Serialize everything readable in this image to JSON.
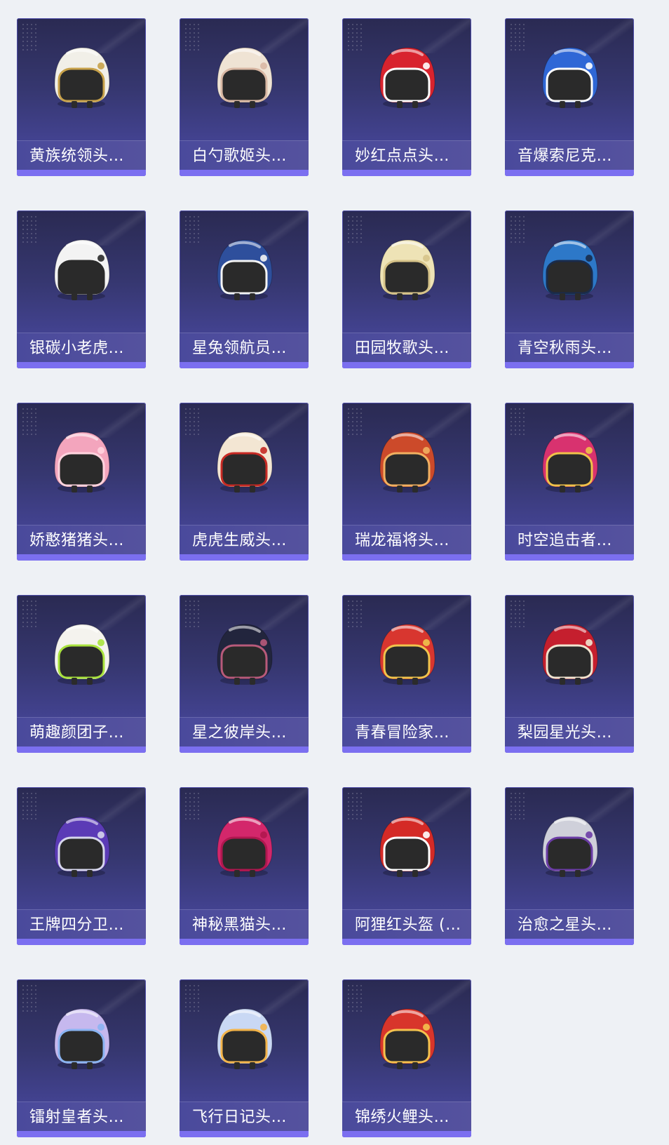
{
  "items": [
    {
      "label": "黄族统领头…",
      "color": "#f1efe8",
      "accent": "#c8a24a",
      "icon": "helmet-icon"
    },
    {
      "label": "白勺歌姬头…",
      "color": "#efe3d4",
      "accent": "#d9b8a4",
      "icon": "helmet-icon"
    },
    {
      "label": "妙红点点头…",
      "color": "#d8232e",
      "accent": "#ffffff",
      "icon": "helmet-icon"
    },
    {
      "label": "音爆索尼克…",
      "color": "#2f67d6",
      "accent": "#ffffff",
      "icon": "helmet-icon"
    },
    {
      "label": "银碳小老虎…",
      "color": "#f3f3f3",
      "accent": "#2a2a2a",
      "icon": "helmet-icon"
    },
    {
      "label": "星兔领航员…",
      "color": "#2e4f9c",
      "accent": "#f4f4f4",
      "icon": "helmet-icon"
    },
    {
      "label": "田园牧歌头…",
      "color": "#eee3b6",
      "accent": "#d6c389",
      "icon": "helmet-icon"
    },
    {
      "label": "青空秋雨头…",
      "color": "#2d78c8",
      "accent": "#1a2b4a",
      "icon": "helmet-icon"
    },
    {
      "label": "娇憨猪猪头…",
      "color": "#f3a5bd",
      "accent": "#ffd3de",
      "icon": "helmet-icon"
    },
    {
      "label": "虎虎生威头…",
      "color": "#f3e6d3",
      "accent": "#c72a24",
      "icon": "helmet-icon"
    },
    {
      "label": "瑞龙福将头…",
      "color": "#cc4a2a",
      "accent": "#f1b061",
      "icon": "helmet-icon"
    },
    {
      "label": "时空追击者…",
      "color": "#d8326f",
      "accent": "#f0c24a",
      "icon": "helmet-icon"
    },
    {
      "label": "萌趣颜团子…",
      "color": "#f4f3ee",
      "accent": "#a9e33d",
      "icon": "helmet-icon"
    },
    {
      "label": "星之彼岸头…",
      "color": "#22253d",
      "accent": "#b85a7a",
      "icon": "helmet-icon"
    },
    {
      "label": "青春冒险家…",
      "color": "#d8362f",
      "accent": "#f0c44c",
      "icon": "helmet-icon"
    },
    {
      "label": "梨园星光头…",
      "color": "#c51f2e",
      "accent": "#f1e4d0",
      "icon": "helmet-icon"
    },
    {
      "label": "王牌四分卫…",
      "color": "#5b3bb6",
      "accent": "#d6d6ec",
      "icon": "helmet-icon"
    },
    {
      "label": "神秘黑猫头…",
      "color": "#d3276b",
      "accent": "#b0174f",
      "icon": "helmet-icon"
    },
    {
      "label": "阿狸红头盔 (…",
      "color": "#d42a26",
      "accent": "#ffffff",
      "icon": "helmet-icon"
    },
    {
      "label": "治愈之星头…",
      "color": "#cfd0da",
      "accent": "#6b3ca6",
      "icon": "helmet-icon"
    },
    {
      "label": "镭射皇者头…",
      "color": "#c6b8ee",
      "accent": "#8ab4f2",
      "icon": "helmet-icon"
    },
    {
      "label": "飞行日记头…",
      "color": "#c9d8f4",
      "accent": "#f3b44a",
      "icon": "helmet-icon"
    },
    {
      "label": "锦绣火鲤头…",
      "color": "#d8352b",
      "accent": "#f4c24e",
      "icon": "helmet-icon"
    }
  ]
}
